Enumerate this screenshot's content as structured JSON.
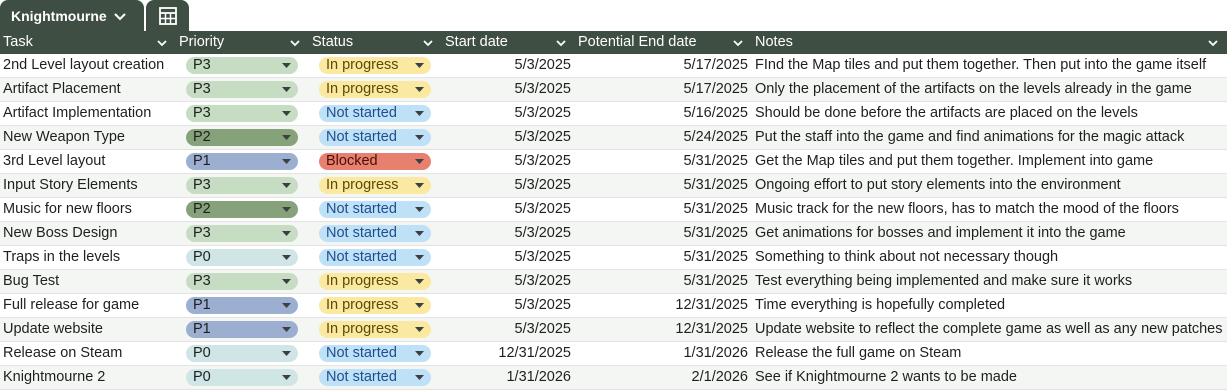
{
  "sheet_tab": {
    "name": "Knightmourne"
  },
  "columns": [
    "Task",
    "Priority",
    "Status",
    "Start date",
    "Potential End date",
    "Notes"
  ],
  "colors": {
    "header_bg": "#3f4e43",
    "P0": "#cfe5e6",
    "P1": "#9cafd0",
    "P2": "#86a27b",
    "P3": "#c6dcc3",
    "In progress": "#fbe9a1",
    "Not started": "#bfe1f7",
    "Blocked": "#e8806f"
  },
  "rows": [
    {
      "task": "2nd Level layout creation",
      "priority": "P3",
      "status": "In progress",
      "start": "5/3/2025",
      "end": "5/17/2025",
      "notes": "FInd the Map tiles and put them together. Then put into the game itself"
    },
    {
      "task": "Artifact Placement",
      "priority": "P3",
      "status": "In progress",
      "start": "5/3/2025",
      "end": "5/17/2025",
      "notes": "Only the placement of the artifacts on the levels already in the game"
    },
    {
      "task": "Artifact Implementation",
      "priority": "P3",
      "status": "Not started",
      "start": "5/3/2025",
      "end": "5/16/2025",
      "notes": "Should be done before the artifacts are placed on the levels"
    },
    {
      "task": "New Weapon Type",
      "priority": "P2",
      "status": "Not started",
      "start": "5/3/2025",
      "end": "5/24/2025",
      "notes": "Put the staff into the game and find animations for the magic attack"
    },
    {
      "task": "3rd Level layout",
      "priority": "P1",
      "status": "Blocked",
      "start": "5/3/2025",
      "end": "5/31/2025",
      "notes": "Get the Map tiles and put them together. Implement into game"
    },
    {
      "task": "Input Story Elements",
      "priority": "P3",
      "status": "In progress",
      "start": "5/3/2025",
      "end": "5/31/2025",
      "notes": "Ongoing effort to put story elements into the environment"
    },
    {
      "task": "Music for new floors",
      "priority": "P2",
      "status": "Not started",
      "start": "5/3/2025",
      "end": "5/31/2025",
      "notes": "Music track for the new floors, has to match the mood of the floors"
    },
    {
      "task": "New Boss Design",
      "priority": "P3",
      "status": "Not started",
      "start": "5/3/2025",
      "end": "5/31/2025",
      "notes": "Get animations for bosses and implement it into the game"
    },
    {
      "task": "Traps in the levels",
      "priority": "P0",
      "status": "Not started",
      "start": "5/3/2025",
      "end": "5/31/2025",
      "notes": "Something to think about not necessary though"
    },
    {
      "task": "Bug Test",
      "priority": "P3",
      "status": "In progress",
      "start": "5/3/2025",
      "end": "5/31/2025",
      "notes": "Test everything being implemented and make sure it works"
    },
    {
      "task": "Full release for game",
      "priority": "P1",
      "status": "In progress",
      "start": "5/3/2025",
      "end": "12/31/2025",
      "notes": "Time everything is hopefully completed"
    },
    {
      "task": "Update website",
      "priority": "P1",
      "status": "In progress",
      "start": "5/3/2025",
      "end": "12/31/2025",
      "notes": "Update website to reflect the complete game as well as any new patches"
    },
    {
      "task": "Release on Steam",
      "priority": "P0",
      "status": "Not started",
      "start": "12/31/2025",
      "end": "1/31/2026",
      "notes": "Release the full game on Steam"
    },
    {
      "task": "Knightmourne 2",
      "priority": "P0",
      "status": "Not started",
      "start": "1/31/2026",
      "end": "2/1/2026",
      "notes": "See if Knightmourne 2 wants to be made"
    }
  ]
}
